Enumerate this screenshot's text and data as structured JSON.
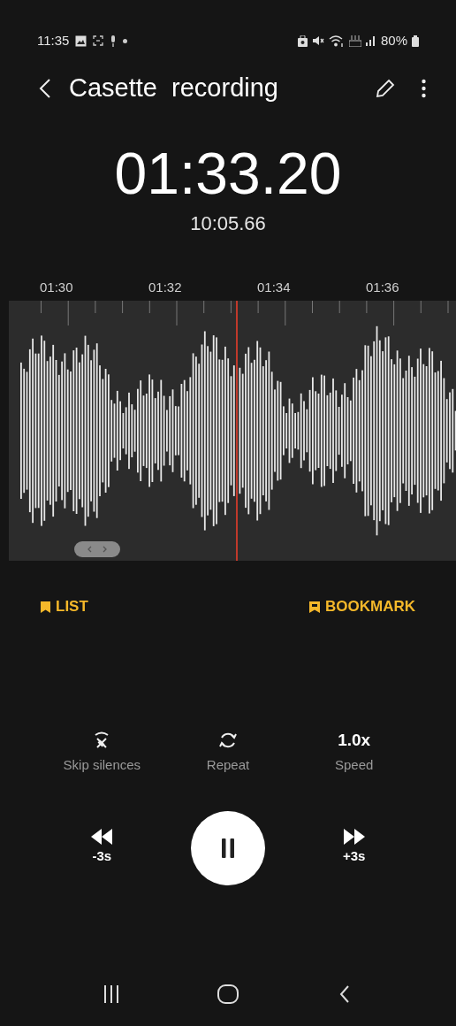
{
  "status_bar": {
    "time": "11:35",
    "battery": "80%"
  },
  "toolbar": {
    "title": "Casette  recording"
  },
  "player": {
    "position": "01:33.20",
    "duration": "10:05.66"
  },
  "timeline": {
    "ticks": [
      "01:30",
      "01:32",
      "01:34",
      "01:36"
    ]
  },
  "actions": [
    {
      "kind": "list",
      "label": "LIST"
    },
    {
      "kind": "bookmark",
      "label": "BOOKMARK"
    }
  ],
  "options": [
    {
      "kind": "skip",
      "label": "Skip silences"
    },
    {
      "kind": "repeat",
      "label": "Repeat"
    },
    {
      "kind": "speed",
      "value": "1.0x",
      "label": "Speed"
    }
  ],
  "transport": {
    "rewind": "-3s",
    "forward": "+3s"
  }
}
